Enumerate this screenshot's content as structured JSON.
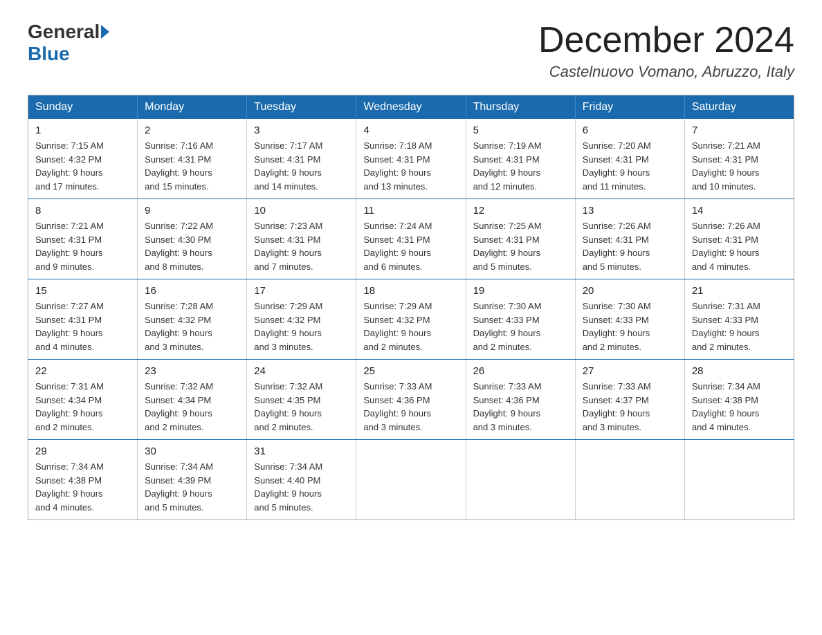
{
  "logo": {
    "general": "General",
    "blue": "Blue"
  },
  "header": {
    "title": "December 2024",
    "subtitle": "Castelnuovo Vomano, Abruzzo, Italy"
  },
  "weekdays": [
    "Sunday",
    "Monday",
    "Tuesday",
    "Wednesday",
    "Thursday",
    "Friday",
    "Saturday"
  ],
  "weeks": [
    [
      {
        "day": "1",
        "sunrise": "7:15 AM",
        "sunset": "4:32 PM",
        "daylight": "9 hours and 17 minutes."
      },
      {
        "day": "2",
        "sunrise": "7:16 AM",
        "sunset": "4:31 PM",
        "daylight": "9 hours and 15 minutes."
      },
      {
        "day": "3",
        "sunrise": "7:17 AM",
        "sunset": "4:31 PM",
        "daylight": "9 hours and 14 minutes."
      },
      {
        "day": "4",
        "sunrise": "7:18 AM",
        "sunset": "4:31 PM",
        "daylight": "9 hours and 13 minutes."
      },
      {
        "day": "5",
        "sunrise": "7:19 AM",
        "sunset": "4:31 PM",
        "daylight": "9 hours and 12 minutes."
      },
      {
        "day": "6",
        "sunrise": "7:20 AM",
        "sunset": "4:31 PM",
        "daylight": "9 hours and 11 minutes."
      },
      {
        "day": "7",
        "sunrise": "7:21 AM",
        "sunset": "4:31 PM",
        "daylight": "9 hours and 10 minutes."
      }
    ],
    [
      {
        "day": "8",
        "sunrise": "7:21 AM",
        "sunset": "4:31 PM",
        "daylight": "9 hours and 9 minutes."
      },
      {
        "day": "9",
        "sunrise": "7:22 AM",
        "sunset": "4:30 PM",
        "daylight": "9 hours and 8 minutes."
      },
      {
        "day": "10",
        "sunrise": "7:23 AM",
        "sunset": "4:31 PM",
        "daylight": "9 hours and 7 minutes."
      },
      {
        "day": "11",
        "sunrise": "7:24 AM",
        "sunset": "4:31 PM",
        "daylight": "9 hours and 6 minutes."
      },
      {
        "day": "12",
        "sunrise": "7:25 AM",
        "sunset": "4:31 PM",
        "daylight": "9 hours and 5 minutes."
      },
      {
        "day": "13",
        "sunrise": "7:26 AM",
        "sunset": "4:31 PM",
        "daylight": "9 hours and 5 minutes."
      },
      {
        "day": "14",
        "sunrise": "7:26 AM",
        "sunset": "4:31 PM",
        "daylight": "9 hours and 4 minutes."
      }
    ],
    [
      {
        "day": "15",
        "sunrise": "7:27 AM",
        "sunset": "4:31 PM",
        "daylight": "9 hours and 4 minutes."
      },
      {
        "day": "16",
        "sunrise": "7:28 AM",
        "sunset": "4:32 PM",
        "daylight": "9 hours and 3 minutes."
      },
      {
        "day": "17",
        "sunrise": "7:29 AM",
        "sunset": "4:32 PM",
        "daylight": "9 hours and 3 minutes."
      },
      {
        "day": "18",
        "sunrise": "7:29 AM",
        "sunset": "4:32 PM",
        "daylight": "9 hours and 2 minutes."
      },
      {
        "day": "19",
        "sunrise": "7:30 AM",
        "sunset": "4:33 PM",
        "daylight": "9 hours and 2 minutes."
      },
      {
        "day": "20",
        "sunrise": "7:30 AM",
        "sunset": "4:33 PM",
        "daylight": "9 hours and 2 minutes."
      },
      {
        "day": "21",
        "sunrise": "7:31 AM",
        "sunset": "4:33 PM",
        "daylight": "9 hours and 2 minutes."
      }
    ],
    [
      {
        "day": "22",
        "sunrise": "7:31 AM",
        "sunset": "4:34 PM",
        "daylight": "9 hours and 2 minutes."
      },
      {
        "day": "23",
        "sunrise": "7:32 AM",
        "sunset": "4:34 PM",
        "daylight": "9 hours and 2 minutes."
      },
      {
        "day": "24",
        "sunrise": "7:32 AM",
        "sunset": "4:35 PM",
        "daylight": "9 hours and 2 minutes."
      },
      {
        "day": "25",
        "sunrise": "7:33 AM",
        "sunset": "4:36 PM",
        "daylight": "9 hours and 3 minutes."
      },
      {
        "day": "26",
        "sunrise": "7:33 AM",
        "sunset": "4:36 PM",
        "daylight": "9 hours and 3 minutes."
      },
      {
        "day": "27",
        "sunrise": "7:33 AM",
        "sunset": "4:37 PM",
        "daylight": "9 hours and 3 minutes."
      },
      {
        "day": "28",
        "sunrise": "7:34 AM",
        "sunset": "4:38 PM",
        "daylight": "9 hours and 4 minutes."
      }
    ],
    [
      {
        "day": "29",
        "sunrise": "7:34 AM",
        "sunset": "4:38 PM",
        "daylight": "9 hours and 4 minutes."
      },
      {
        "day": "30",
        "sunrise": "7:34 AM",
        "sunset": "4:39 PM",
        "daylight": "9 hours and 5 minutes."
      },
      {
        "day": "31",
        "sunrise": "7:34 AM",
        "sunset": "4:40 PM",
        "daylight": "9 hours and 5 minutes."
      },
      null,
      null,
      null,
      null
    ]
  ]
}
